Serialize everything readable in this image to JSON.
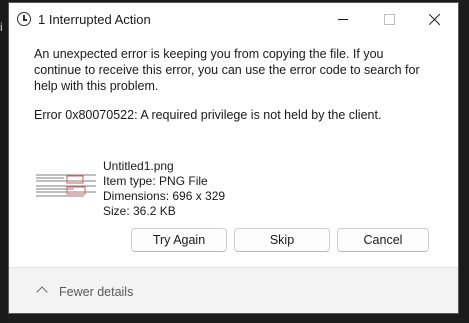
{
  "backdrop": {
    "glyph": "i"
  },
  "dialog": {
    "title": "1 Interrupted Action",
    "message": "An unexpected error is keeping you from copying the file. If you continue to receive this error, you can use the error code to search for help with this problem.",
    "error": "Error 0x80070522: A required privilege is not held by the client.",
    "file": {
      "name": "Untitled1.png",
      "type": "Item type: PNG File",
      "dimensions": "Dimensions: 696 x 329",
      "size": "Size: 36.2 KB"
    },
    "buttons": {
      "try_again": "Try Again",
      "skip": "Skip",
      "cancel": "Cancel"
    },
    "footer": {
      "toggle_label": "Fewer details"
    }
  },
  "icons": {
    "title": "clock-icon",
    "minimize": "minimize-icon",
    "maximize": "maximize-icon",
    "close": "close-icon",
    "chevron": "chevron-up-icon"
  },
  "colors": {
    "dialog_bg": "#ffffff",
    "footer_bg": "#f3f3f3",
    "text": "#1a1a1a",
    "thumbnail_accent": "#e05a5a"
  }
}
